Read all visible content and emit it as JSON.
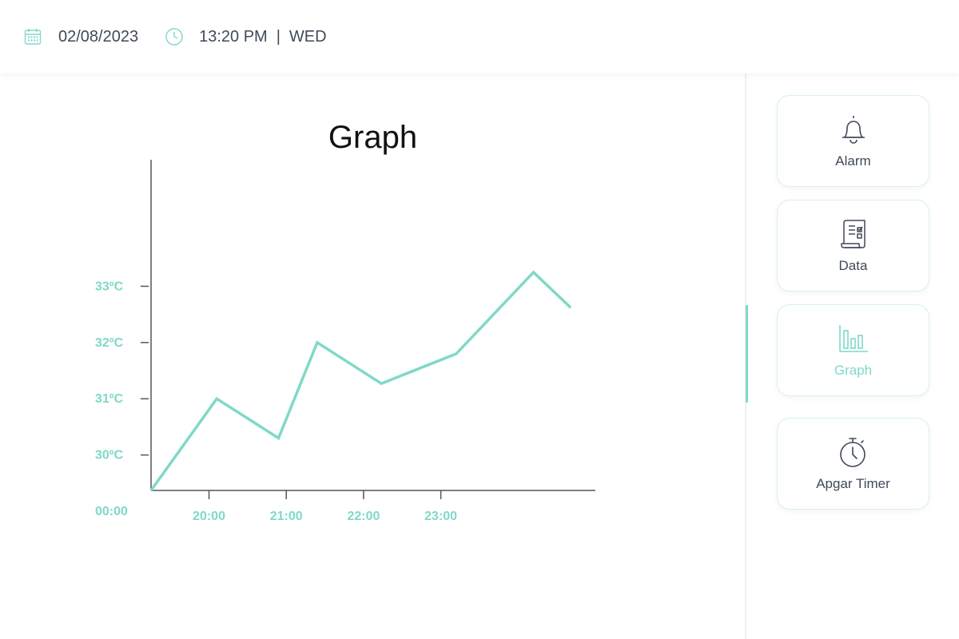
{
  "header": {
    "date": "02/08/2023",
    "time": "13:20 PM",
    "separator": "|",
    "day": "WED"
  },
  "sidebar": {
    "items": [
      {
        "label": "Alarm",
        "icon": "bell-icon",
        "active": false
      },
      {
        "label": "Data",
        "icon": "document-checklist-icon",
        "active": false
      },
      {
        "label": "Graph",
        "icon": "bar-chart-icon",
        "active": true
      },
      {
        "label": "Apgar Timer",
        "icon": "stopwatch-icon",
        "active": false
      }
    ]
  },
  "colors": {
    "accent": "#7fd9c8",
    "text": "#3f4a5a",
    "axis": "#555555"
  },
  "chart_data": {
    "type": "line",
    "title": "Graph",
    "origin_label": "00:00",
    "x_ticks": [
      {
        "label": "20:00",
        "value": 20
      },
      {
        "label": "21:00",
        "value": 21
      },
      {
        "label": "22:00",
        "value": 22
      },
      {
        "label": "23:00",
        "value": 23
      }
    ],
    "y_ticks": [
      {
        "label": "30ºC",
        "value": 30
      },
      {
        "label": "31ºC",
        "value": 31
      },
      {
        "label": "32ºC",
        "value": 32
      },
      {
        "label": "33ºC",
        "value": 33
      }
    ],
    "xlim": [
      19.25,
      25.0
    ],
    "ylim": [
      29.37,
      35.25
    ],
    "series": [
      {
        "x": [
          19.25,
          20.1,
          20.9,
          21.4,
          22.23,
          23.2,
          24.2,
          24.68
        ],
        "y": [
          29.37,
          31.0,
          30.3,
          32.0,
          31.27,
          31.8,
          33.25,
          32.62
        ]
      }
    ],
    "grid": false
  }
}
